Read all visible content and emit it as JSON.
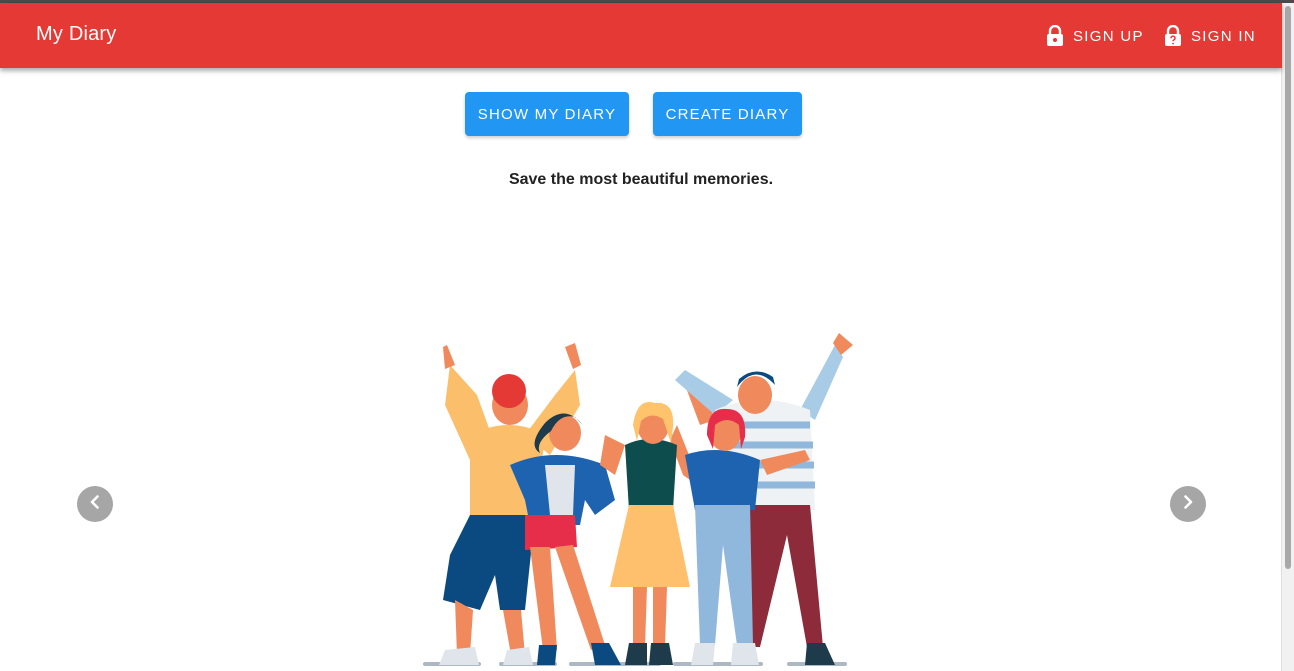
{
  "header": {
    "title": "My Diary",
    "signup_label": "SIGN UP",
    "signin_label": "SIGN IN"
  },
  "actions": {
    "show_label": "SHOW MY DIARY",
    "create_label": "CREATE DIARY"
  },
  "tagline": "Save the most beautiful memories.",
  "carousel": {
    "prev_icon": "chevron-left-icon",
    "next_icon": "chevron-right-icon"
  },
  "colors": {
    "appbar": "#e53935",
    "primary_button": "#2196f3",
    "carousel_arrow": "#a6a6a6"
  }
}
